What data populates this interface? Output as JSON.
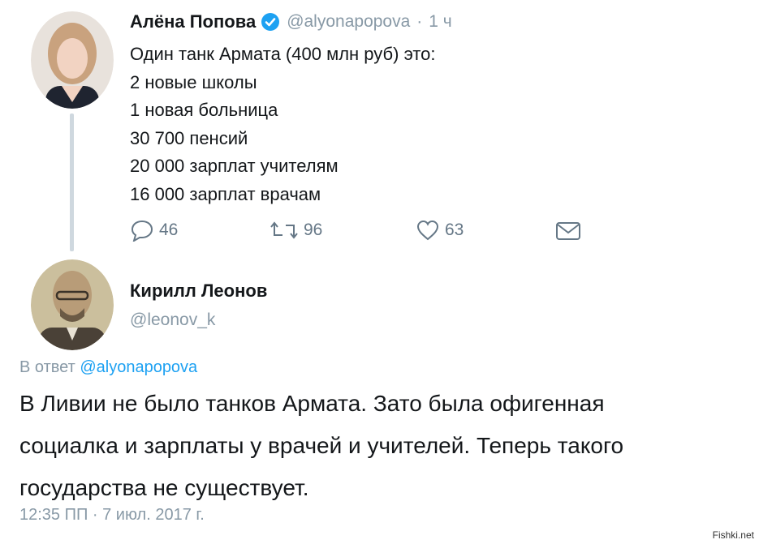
{
  "tweet": {
    "author_name": "Алёна Попова",
    "author_handle": "@alyonapopova",
    "separator": "·",
    "time": "1 ч",
    "lines": [
      "Один танк Армата (400 млн руб) это:",
      "2 новые школы",
      "1 новая больница",
      "30 700 пенсий",
      "20 000 зарплат учителям",
      "16 000 зарплат врачам"
    ],
    "actions": {
      "reply_count": "46",
      "retweet_count": "96",
      "like_count": "63"
    }
  },
  "reply": {
    "author_name": "Кирилл Леонов",
    "author_handle": "@leonov_k",
    "in_reply_prefix": "В ответ",
    "in_reply_handle": "@alyonapopova",
    "lines": [
      "В Ливии не было танков Армата. Зато была офигенная",
      "социалка и зарплаты у врачей и учителей. Теперь такого",
      "государства не существует."
    ],
    "timestamp": "12:35 ПП · 7 июл. 2017 г."
  },
  "watermark": "Fishki.net",
  "colors": {
    "verified": "#1da1f2",
    "link": "#1da1f2",
    "muted": "#8899a6",
    "text": "#14171a"
  }
}
